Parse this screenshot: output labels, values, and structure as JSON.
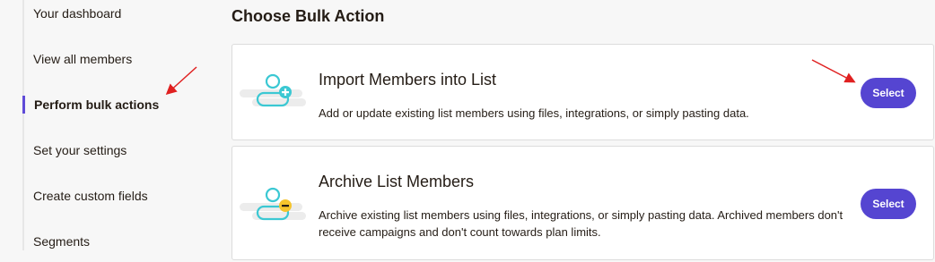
{
  "sidebar": {
    "items": [
      {
        "label": "Your dashboard"
      },
      {
        "label": "View all members"
      },
      {
        "label": "Perform bulk actions",
        "active": true
      },
      {
        "label": "Set your settings"
      },
      {
        "label": "Create custom fields"
      },
      {
        "label": "Segments"
      }
    ]
  },
  "main": {
    "title": "Choose Bulk Action",
    "cards": [
      {
        "title": "Import Members into List",
        "description": "Add or update existing list members using files, integrations, or simply pasting data.",
        "button_label": "Select",
        "icon": "user-add-icon"
      },
      {
        "title": "Archive List Members",
        "description": "Archive existing list members using files, integrations, or simply pasting data. Archived members don't receive campaigns and don't count towards plan limits.",
        "button_label": "Select",
        "icon": "user-archive-icon"
      }
    ]
  },
  "colors": {
    "accent": "#5545d1",
    "annotation_arrow": "#e02020",
    "icon_teal": "#3bc8d3",
    "icon_yellow": "#f5c42c"
  }
}
